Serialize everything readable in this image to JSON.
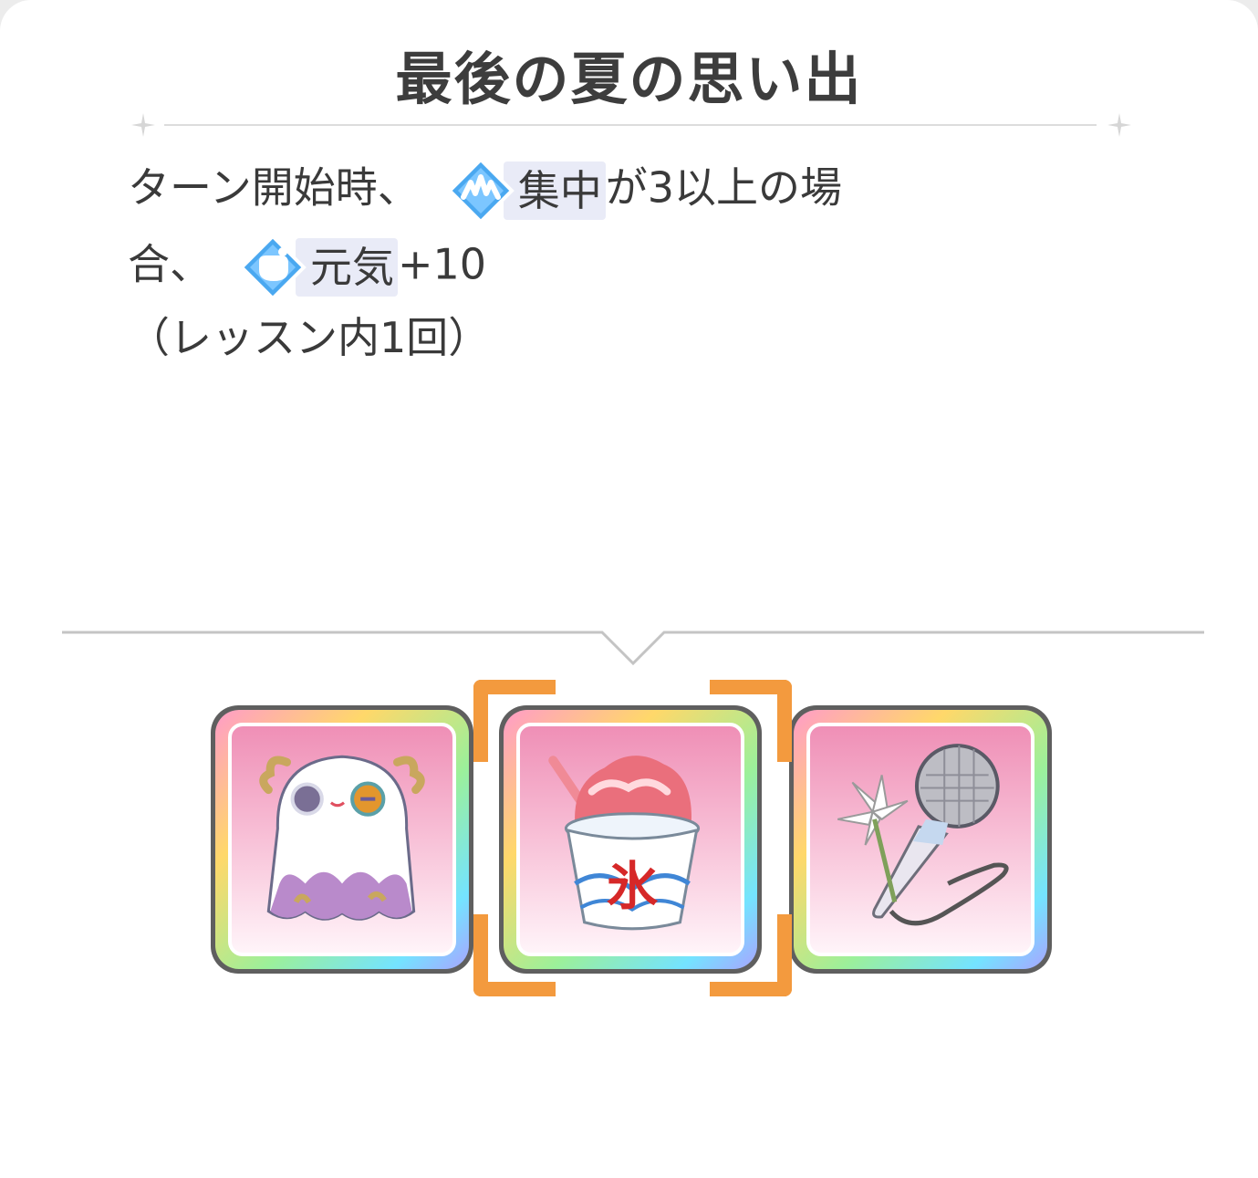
{
  "skill": {
    "title": "最後の夏の思い出",
    "line1_prefix": "ターン開始時、",
    "effect1": {
      "icon": "focus-icon",
      "label": "集中"
    },
    "line1_suffix": "が3以上の場",
    "line2_prefix": "合、",
    "effect2": {
      "icon": "energy-icon",
      "label": "元気"
    },
    "line2_suffix": "+10",
    "line3": "（レッスン内1回）"
  },
  "carousel": {
    "selected_index": 1,
    "items": [
      {
        "icon": "ghost-plush-icon"
      },
      {
        "icon": "shaved-ice-icon",
        "glyph": "氷"
      },
      {
        "icon": "microphone-lily-icon"
      }
    ]
  },
  "colors": {
    "accent": "#f39a3e",
    "effect_blue": "#4aa8f0",
    "tag_bg": "#e9ebf7"
  }
}
